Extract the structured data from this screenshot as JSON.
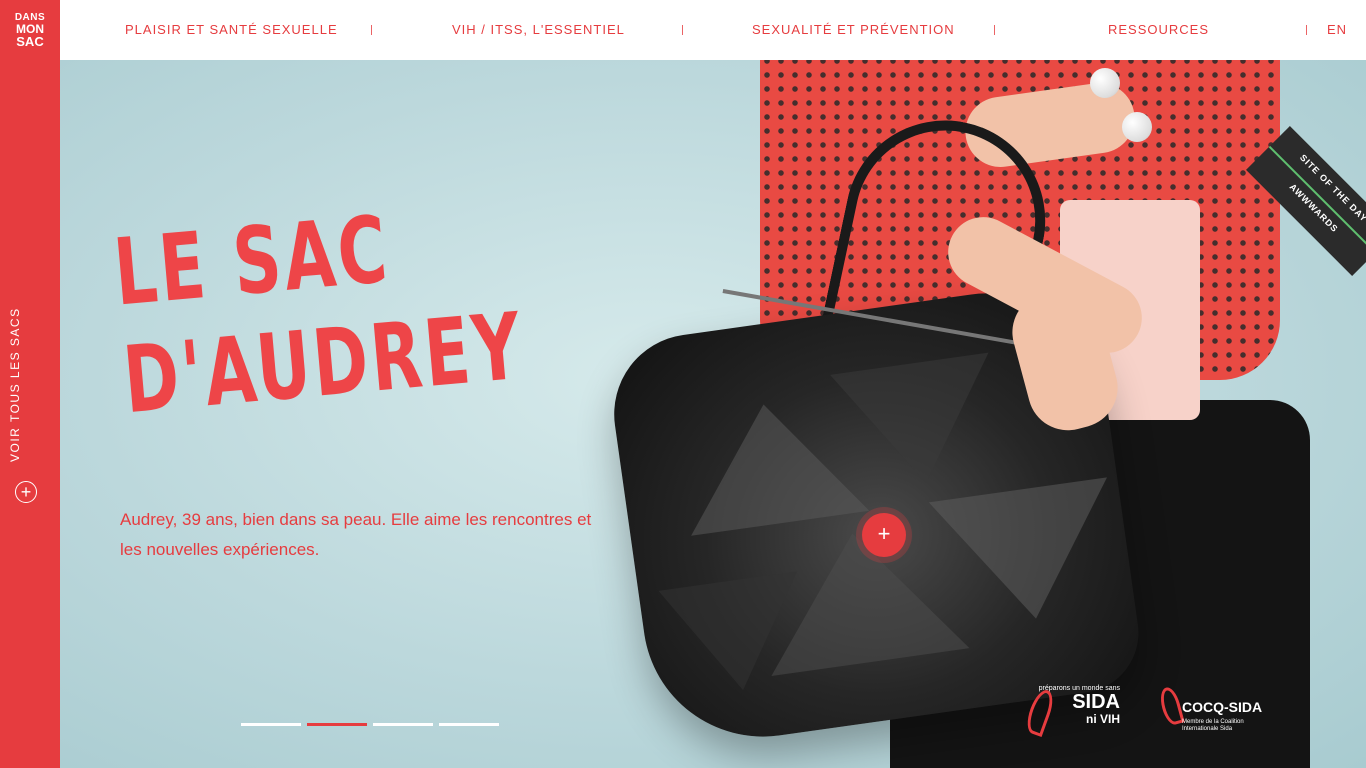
{
  "brand": {
    "logo_line1": "DANS",
    "logo_line2": "MON",
    "logo_line3": "SAC",
    "color": "#e63c3f"
  },
  "nav": {
    "items": [
      {
        "label": "PLAISIR ET SANTÉ SEXUELLE"
      },
      {
        "label": "VIH / ITSS, L'ESSENTIEL"
      },
      {
        "label": "SEXUALITÉ ET PRÉVENTION"
      },
      {
        "label": "RESSOURCES"
      },
      {
        "label": "EN"
      }
    ]
  },
  "sidebar": {
    "label": "VOIR TOUS LES SACS",
    "plus_icon": "plus-circle-icon"
  },
  "hero": {
    "title_line1": "LE SAC",
    "title_line2": "D'AUDREY",
    "description": "Audrey, 39 ans, bien dans sa peau. Elle aime les rencontres et les nouvelles expériences.",
    "bag_button_icon": "plus-icon",
    "slides_total": 4,
    "active_slide": 2
  },
  "partners": {
    "p1_small": "préparons un monde sans",
    "p1_line1": "SIDA",
    "p1_line2": "ni VIH",
    "p2_name": "COCQ-SIDA",
    "p2_tag": "Membre de la Coalition Internationale Sida"
  },
  "award": {
    "line1": "SITE OF THE DAY",
    "line2": "AWWWARDS"
  }
}
